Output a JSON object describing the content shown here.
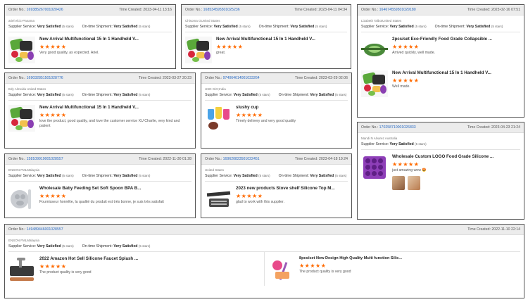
{
  "cards": [
    {
      "order_label": "Order No.:",
      "order_no": "169385267001020426",
      "time_label": "Time Created:",
      "time": "2023-04-11 13:16",
      "meta": "ariel elcic-Panama",
      "supplier_label": "Supplier Service:",
      "supplier_value": "Very Satisfied",
      "supplier_stars": "(5 stars)",
      "ontime_label": "On-time Shipment:",
      "ontime_value": "Very Satisfied",
      "ontime_stars": "(5 stars)",
      "products": [
        {
          "title": "New Arrival Multifunctional 15 In 1 Handheld V...",
          "stars": "★★★★★",
          "review": "Very good quality, as expected. Ariel.",
          "thumb": "vegetable-chopper"
        }
      ]
    },
    {
      "order_label": "Order No.:",
      "order_no": "168534595501025236",
      "time_label": "Time Created:",
      "time": "2023-04-11 04:34",
      "meta": "Chisoma OUnited States",
      "supplier_label": "Supplier Service:",
      "supplier_value": "Very Satisfied",
      "supplier_stars": "(5 stars)",
      "ontime_label": "On-time Shipment:",
      "ontime_value": "Very Satisfied",
      "ontime_stars": "(5 stars)",
      "products": [
        {
          "title": "New Arrival Multifunctional 15 In 1 Handheld V...",
          "stars": "★★★★★",
          "review": "great.",
          "thumb": "vegetable-chopper"
        }
      ]
    },
    {
      "order_label": "Order No.:",
      "order_no": "164674559501029180",
      "time_label": "Time Created:",
      "time": "2023-02-16 07:51",
      "meta": "Lizabeth TalbotUnited States",
      "supplier_label": "Supplier Service:",
      "supplier_value": "Very Satisfied",
      "supplier_stars": "(5 stars)",
      "ontime_label": "On-time Shipment:",
      "ontime_value": "Very Satisfied",
      "ontime_stars": "(5 stars)",
      "products": [
        {
          "title": "2pcs/set Eco-Friendly Food Grade Collapsible ...",
          "stars": "★★★★★",
          "review": "Arrived quickly, well made.",
          "thumb": "collapsible-bowl"
        },
        {
          "title": "New Arrival Multifunctional 15 In 1 Handheld V...",
          "stars": "★★★★★",
          "review": "Well made.",
          "thumb": "vegetable-chopper"
        }
      ]
    },
    {
      "order_label": "Order No.:",
      "order_no": "169032851501028776",
      "time_label": "Time Created:",
      "time": "2023-03-27 20:23",
      "meta": "Edy Almeida United States",
      "supplier_label": "Supplier Service:",
      "supplier_value": "Very Satisfied",
      "supplier_stars": "(5 stars)",
      "ontime_label": "On-time Shipment:",
      "ontime_value": "Very Satisfied",
      "ontime_stars": "(5 stars)",
      "products": [
        {
          "title": "New Arrival Multifunctional 15 In 1 Handheld V...",
          "stars": "★★★★★",
          "review": "love the product, good quality, and love the customer service XU Charlie, very kind and patient",
          "thumb": "vegetable-chopper"
        }
      ]
    },
    {
      "order_label": "Order No.:",
      "order_no": "974064614001033264",
      "time_label": "Time Created:",
      "time": "2023-03-29 02:06",
      "meta": "USD GiG;India",
      "supplier_label": "Supplier Service:",
      "supplier_value": "Very Satisfied",
      "supplier_stars": "(5 stars)",
      "ontime_label": "On-time Shipment:",
      "ontime_value": "Very Satisfied",
      "ontime_stars": "(5 stars)",
      "products": [
        {
          "title": "slushy cup",
          "stars": "★★★★★",
          "review": "Timely delivery and very good quality",
          "thumb": "slushy-cup"
        }
      ]
    },
    {
      "order_label": "Order No.:",
      "order_no": "170258710001026833",
      "time_label": "Time Created:",
      "time": "2023-04-23 21:24",
      "meta": "Mandi N Alvarez Australia",
      "supplier_label": "Supplier Service:",
      "supplier_value": "Very Satisfied",
      "supplier_stars": "(5 stars)",
      "ontime_label": "",
      "ontime_value": "",
      "ontime_stars": "",
      "products": [
        {
          "title": "Wholesale Custom LOGO Food Grade Silicone ...",
          "stars": "★★★★★",
          "review": "just amazing wow 🤩",
          "thumb": "silicone-mold"
        }
      ]
    },
    {
      "order_label": "Order No.:",
      "order_no": "158109919001028557",
      "time_label": "Time Created:",
      "time": "2022-11-30 01:28",
      "meta": "ENSON FMLMalaysia",
      "supplier_label": "Supplier Service:",
      "supplier_value": "Very Satisfied",
      "supplier_stars": "(5 stars)",
      "ontime_label": "On-time Shipment:",
      "ontime_value": "Very Satisfied",
      "ontime_stars": "(5 stars)",
      "products": [
        {
          "title": "Wholesale Baby Feeding Set Soft Spoon BPA B...",
          "stars": "★★★★★",
          "review": "Fournisseur honnête, la qualité du produit est très bonne, je suis très satisfait",
          "thumb": "baby-feeding-set"
        }
      ]
    },
    {
      "order_label": "Order No.:",
      "order_no": "169620823501022451",
      "time_label": "Time Created:",
      "time": "2023-04-18 19:24",
      "meta": "United States",
      "supplier_label": "Supplier Service:",
      "supplier_value": "Very Satisfied",
      "supplier_stars": "(5 stars)",
      "ontime_label": "On-time Shipment:",
      "ontime_value": "Very Satisfied",
      "ontime_stars": "(5 stars)",
      "products": [
        {
          "title": "2023 new products Stove shelf Silicone Top M...",
          "stars": "★★★★★",
          "review": "glad to work with this supplier.",
          "thumb": "stove-shelf"
        }
      ]
    },
    {
      "order_label": "Order No.:",
      "order_no": "149489446001028557",
      "time_label": "Time Created:",
      "time": "2022-11-10 22:14",
      "meta": "ENSON FMLMalaysia",
      "supplier_label": "Supplier Service:",
      "supplier_value": "Very Satisfied",
      "supplier_stars": "(5 stars)",
      "ontime_label": "On-time Shipment:",
      "ontime_value": "Very Satisfied",
      "ontime_stars": "(5 stars)",
      "products": [
        {
          "title": "2022 Amazon Hot Sell Silicone Faucet Splash ...",
          "stars": "★★★★★",
          "review": "The product quality is very good",
          "thumb": "faucet-splash-mat"
        },
        {
          "title": "8pcs/set New Design High Quality Multi function Silic...",
          "stars": "★★★★★",
          "review": "The product quality is very good",
          "thumb": "utensil-set"
        }
      ]
    }
  ],
  "colors": {
    "accent": "#ff6a00",
    "link": "#2b6cc4",
    "header_bg": "#ececec"
  }
}
